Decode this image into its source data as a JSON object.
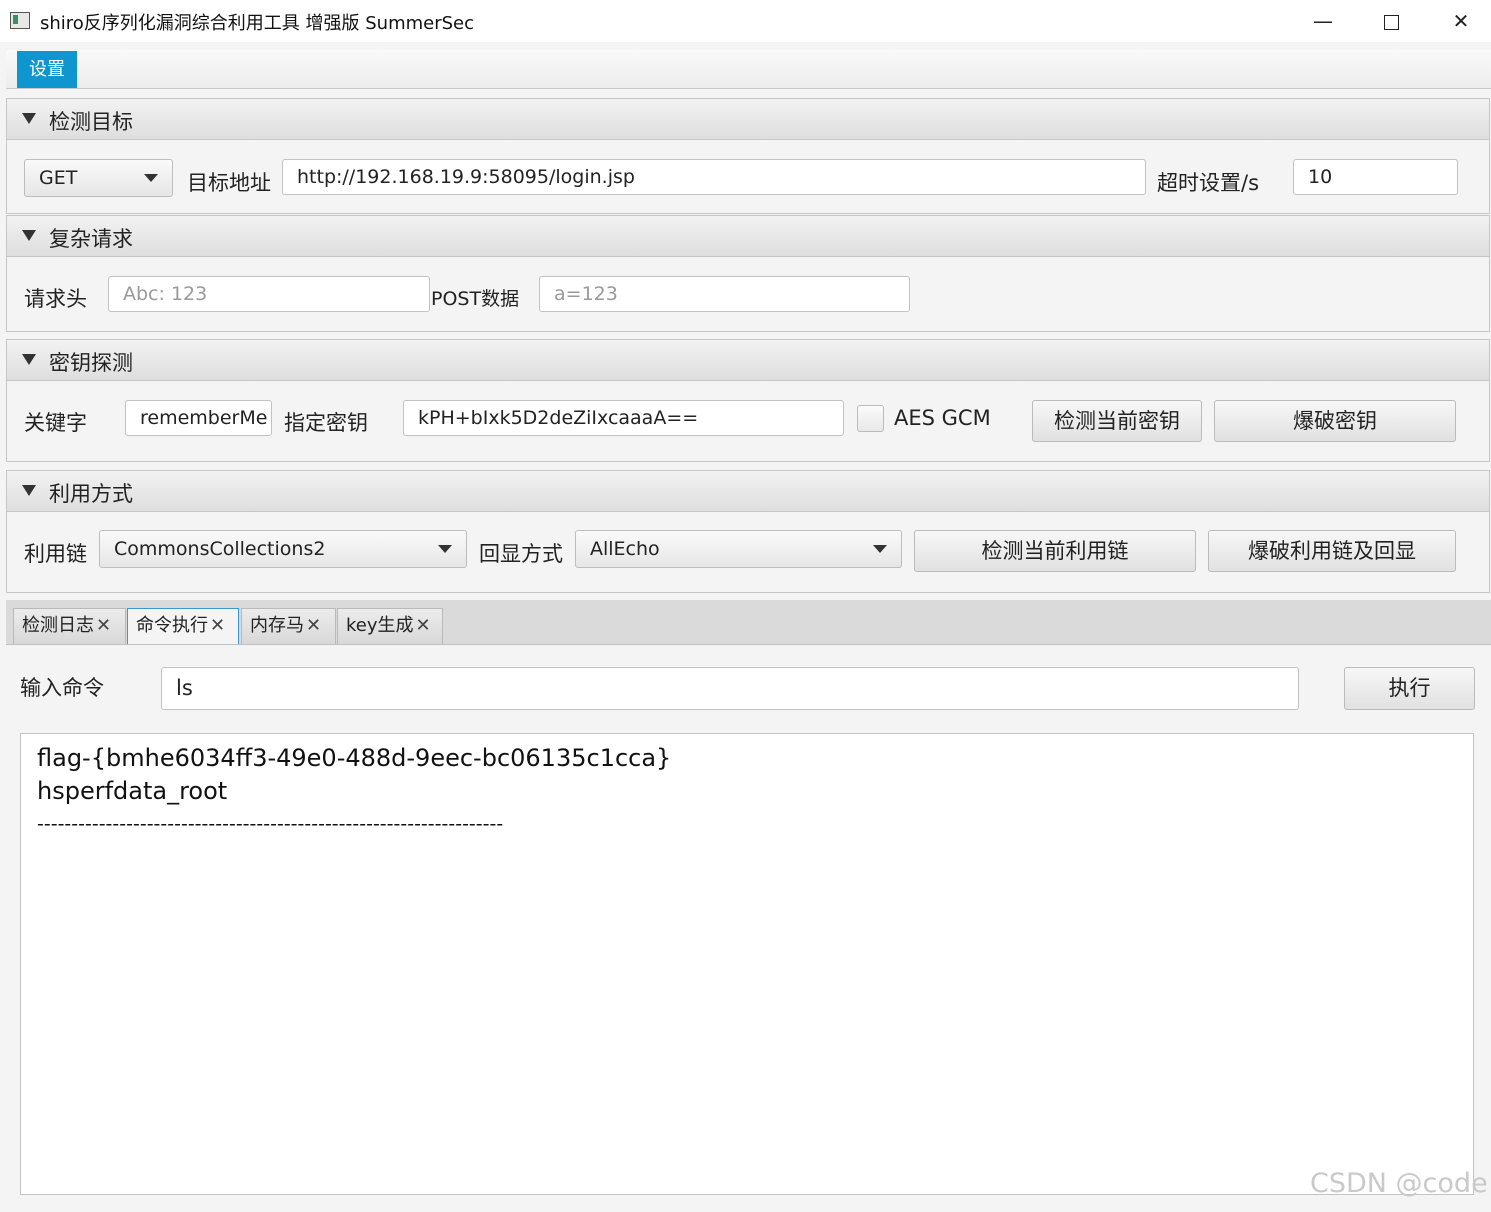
{
  "window": {
    "title": "shiro反序列化漏洞综合利用工具 增强版 SummerSec",
    "minimize": "—",
    "close": "✕"
  },
  "menu": {
    "settings": "设置"
  },
  "target": {
    "title": "检测目标",
    "method": "GET",
    "url_label": "目标地址",
    "url": "http://192.168.19.9:58095/login.jsp",
    "timeout_label": "超时设置/s",
    "timeout": "10"
  },
  "complex": {
    "title": "复杂请求",
    "header_label": "请求头",
    "header_placeholder": "Abc: 123",
    "post_label": "POST数据",
    "post_placeholder": "a=123"
  },
  "key": {
    "title": "密钥探测",
    "keyword_label": "关键字",
    "keyword": "rememberMe",
    "key_label": "指定密钥",
    "key": "kPH+bIxk5D2deZiIxcaaaA==",
    "aes_gcm": "AES GCM",
    "aes_gcm_checked": false,
    "detect_button": "检测当前密钥",
    "brute_button": "爆破密钥"
  },
  "exploit": {
    "title": "利用方式",
    "chain_label": "利用链",
    "chain": "CommonsCollections2",
    "echo_label": "回显方式",
    "echo": "AllEcho",
    "detect_button": "检测当前利用链",
    "brute_button": "爆破利用链及回显"
  },
  "tabs": [
    {
      "label": "检测日志",
      "active": false
    },
    {
      "label": "命令执行",
      "active": true
    },
    {
      "label": "内存马",
      "active": false
    },
    {
      "label": "key生成",
      "active": false
    }
  ],
  "command": {
    "input_label": "输入命令",
    "input": "ls",
    "execute_button": "执行",
    "output": [
      "flag-{bmhe6034ff3-49e0-488d-9eec-bc06135c1cca}",
      "hsperfdata_root",
      "--------------------------------------------------------------------"
    ]
  },
  "watermark": "CSDN @code!"
}
